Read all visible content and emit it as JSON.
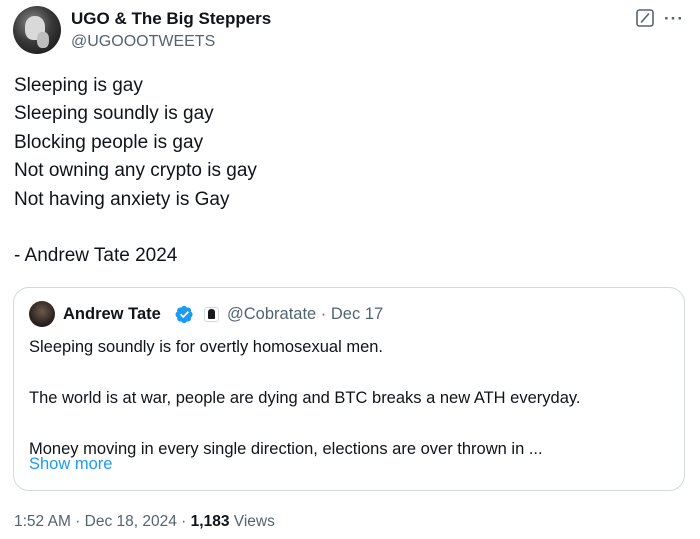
{
  "author": {
    "name": "UGO & The Big Steppers",
    "handle": "@UGOOOTWEETS",
    "avatar_icon": "profile-photo"
  },
  "actions": {
    "grok_icon": "grok-icon",
    "more_icon": "more-icon",
    "more_glyph": "···"
  },
  "tweet": {
    "lines": [
      "Sleeping is gay",
      "Sleeping soundly is gay",
      "Blocking people is gay",
      "Not owning any crypto is gay",
      "Not having anxiety is Gay",
      "",
      "- Andrew Tate 2024"
    ]
  },
  "quote": {
    "name": "Andrew Tate",
    "verified_icon": "verified-badge-icon",
    "affiliate_icon": "affiliate-badge-icon",
    "handle": "@Cobratate",
    "separator": " · ",
    "date": "Dec 17",
    "lines": [
      "Sleeping soundly is for overtly homosexual men.",
      "",
      "The world is at war, people are dying and BTC breaks a new ATH everyday.",
      "",
      "Money moving in every single direction, elections are over thrown in ..."
    ],
    "show_more": "Show more"
  },
  "meta": {
    "time": "1:52 AM",
    "separator": " · ",
    "date": "Dec 18, 2024",
    "views_count": "1,183",
    "views_label": " Views"
  },
  "colors": {
    "text": "#0f1419",
    "secondary": "#536471",
    "link": "#1d9bf0",
    "verified": "#1d9bf0",
    "border": "#cfd9de"
  }
}
